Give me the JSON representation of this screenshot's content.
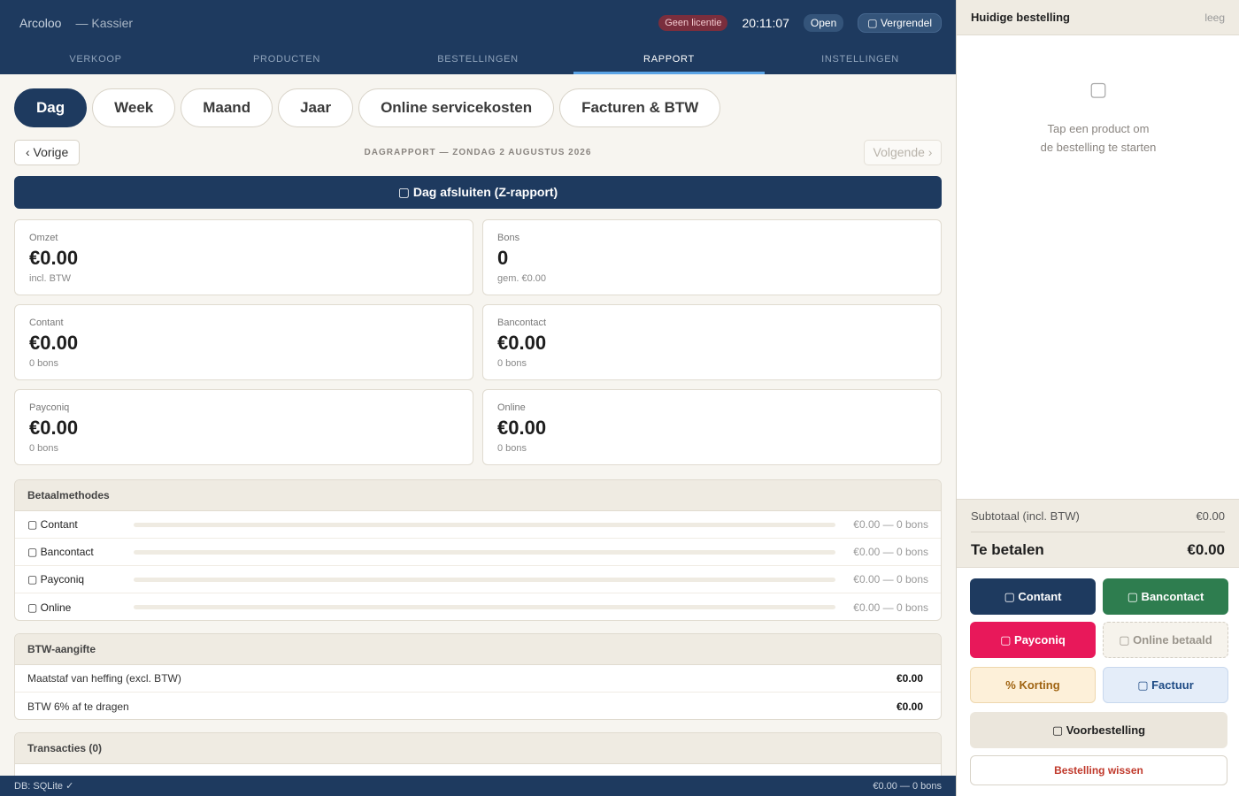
{
  "header": {
    "app_name": "Arcoloo",
    "app_sub": "— Kassier",
    "license_badge": "Geen licentie",
    "clock": "20:11:07",
    "status": "Open",
    "lock_label": "▢ Vergrendel"
  },
  "nav": {
    "tabs": [
      {
        "label": "VERKOOP"
      },
      {
        "label": "PRODUCTEN"
      },
      {
        "label": "BESTELLINGEN"
      },
      {
        "label": "RAPPORT"
      },
      {
        "label": "INSTELLINGEN"
      }
    ],
    "active": "RAPPORT"
  },
  "period": {
    "buttons": [
      {
        "label": "Dag"
      },
      {
        "label": "Week"
      },
      {
        "label": "Maand"
      },
      {
        "label": "Jaar"
      },
      {
        "label": "Online servicekosten"
      },
      {
        "label": "Facturen & BTW"
      }
    ],
    "active": "Dag"
  },
  "report": {
    "prev_label": "‹ Vorige",
    "date_title": "DAGRAPPORT — ZONDAG 2 AUGUSTUS 2026",
    "next_label": "Volgende ›",
    "close_day_label": "▢ Dag afsluiten (Z-rapport)"
  },
  "stats": [
    {
      "label": "Omzet",
      "value": "€0.00",
      "sub": "incl. BTW"
    },
    {
      "label": "Bons",
      "value": "0",
      "sub": "gem. €0.00"
    },
    {
      "label": "Contant",
      "value": "€0.00",
      "sub": "0 bons"
    },
    {
      "label": "Bancontact",
      "value": "€0.00",
      "sub": "0 bons"
    },
    {
      "label": "Payconiq",
      "value": "€0.00",
      "sub": "0 bons"
    },
    {
      "label": "Online",
      "value": "€0.00",
      "sub": "0 bons"
    }
  ],
  "payment_methods": {
    "title": "Betaalmethodes",
    "rows": [
      {
        "name": "▢ Contant",
        "value": "€0.00 — 0 bons",
        "fraction": 0
      },
      {
        "name": "▢ Bancontact",
        "value": "€0.00 — 0 bons",
        "fraction": 0
      },
      {
        "name": "▢ Payconiq",
        "value": "€0.00 — 0 bons",
        "fraction": 0
      },
      {
        "name": "▢ Online",
        "value": "€0.00 — 0 bons",
        "fraction": 0
      }
    ]
  },
  "vat": {
    "title": "BTW-aangifte",
    "rows": [
      {
        "label": "Maatstaf van heffing (excl. BTW)",
        "value": "€0.00"
      },
      {
        "label": "BTW 6% af te dragen",
        "value": "€0.00"
      }
    ]
  },
  "transactions": {
    "title": "Transacties (0)"
  },
  "footer": {
    "db_status": "DB: SQLite ✓",
    "summary": "€0.00 — 0 bons"
  },
  "order": {
    "title": "Huidige bestelling",
    "state": "leeg",
    "empty_icon": "▢",
    "empty_line1": "Tap een product om",
    "empty_line2": "de bestelling te starten",
    "subtotal_label": "Subtotaal (incl. BTW)",
    "subtotal_value": "€0.00",
    "topay_label": "Te betalen",
    "topay_value": "€0.00",
    "buttons": {
      "cash": "▢ Contant",
      "bancontact": "▢ Bancontact",
      "payconiq": "▢ Payconiq",
      "online": "▢ Online betaald",
      "discount": "% Korting",
      "invoice": "▢ Factuur",
      "preorder": "▢ Voorbestelling",
      "clear": "Bestelling wissen"
    }
  },
  "colors": {
    "primary": "#1e3a5f",
    "bancontact": "#2e7d4f",
    "payconiq": "#e8185a",
    "danger": "#c0392b",
    "nav_active_underline": "#5ba4e6"
  }
}
